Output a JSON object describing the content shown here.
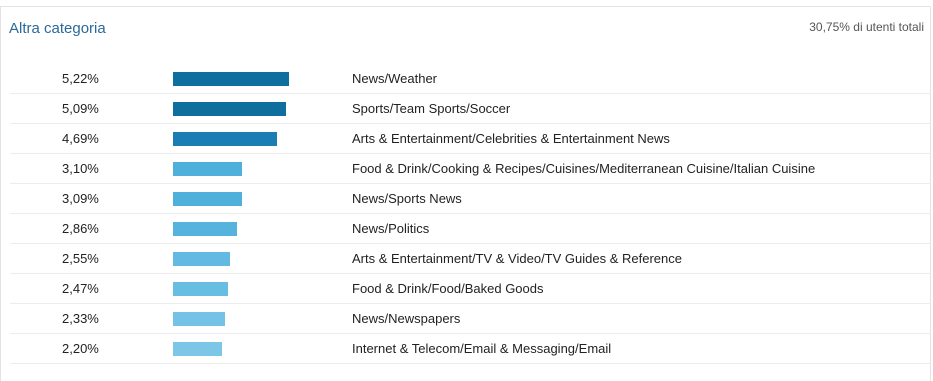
{
  "header": {
    "title": "Altra categoria",
    "total_label": "30,75% di utenti totali"
  },
  "chart_data": {
    "type": "bar",
    "orientation": "horizontal",
    "categories": [
      "News/Weather",
      "Sports/Team Sports/Soccer",
      "Arts & Entertainment/Celebrities & Entertainment News",
      "Food & Drink/Cooking & Recipes/Cuisines/Mediterranean Cuisine/Italian Cuisine",
      "News/Sports News",
      "News/Politics",
      "Arts & Entertainment/TV & Video/TV Guides & Reference",
      "Food & Drink/Food/Baked Goods",
      "News/Newspapers",
      "Internet & Telecom/Email & Messaging/Email"
    ],
    "values": [
      5.22,
      5.09,
      4.69,
      3.1,
      3.09,
      2.86,
      2.55,
      2.47,
      2.33,
      2.2
    ],
    "value_labels": [
      "5,22%",
      "5,09%",
      "4,69%",
      "3,10%",
      "3,09%",
      "2,86%",
      "2,55%",
      "2,47%",
      "2,33%",
      "2,20%"
    ],
    "unit": "%",
    "bar_colors": [
      "#0e6f9e",
      "#0e6f9e",
      "#1a7db4",
      "#4fb0dc",
      "#4fb0dc",
      "#55b3de",
      "#62bae2",
      "#68bde3",
      "#74c2e5",
      "#7cc6e7"
    ],
    "legend": "none",
    "grid": false
  }
}
